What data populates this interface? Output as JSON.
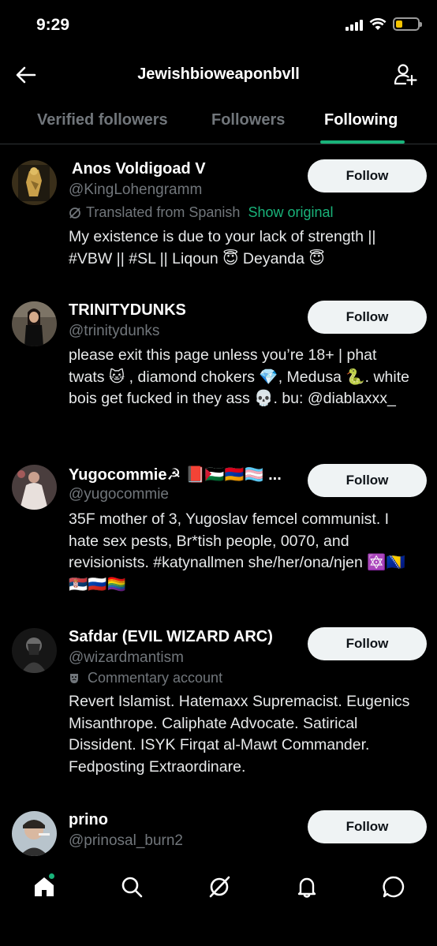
{
  "status_bar": {
    "time": "9:29",
    "icons": [
      "signal-icon",
      "wifi-icon",
      "battery-icon"
    ],
    "battery_color": "#f5c400"
  },
  "header": {
    "title": "Jewishbioweaponbvll",
    "back_icon": "back-arrow-icon",
    "add_icon": "add-user-icon"
  },
  "tabs": [
    {
      "label": "Verified followers",
      "active": false
    },
    {
      "label": "Followers",
      "active": false
    },
    {
      "label": "Following",
      "active": true
    }
  ],
  "accent_color": "#19b37a",
  "users": [
    {
      "name": "Anos Voldigoad V",
      "handle": "@KingLohengramm",
      "translated_label": "Translated from Spanish",
      "show_original": "Show original",
      "bio": "My existence is due to your lack of strength || #VBW || #SL || Liqoun 😇 Deyanda 😇",
      "follow_label": "Follow"
    },
    {
      "name": "TRINITYDUNKS",
      "handle": "@trinitydunks",
      "bio": "please exit this page unless you’re 18+ | phat twats 🐱 , diamond chokers 💎, Medusa 🐍. white bois get fucked in they ass 💀. bu: @diablaxxx_",
      "follow_label": "Follow"
    },
    {
      "name": "Yugocommie☭ 📕🇵🇸🇦🇲🏳️‍⚧️ ...",
      "handle": "@yugocommie",
      "bio": "35F mother of 3, Yugoslav femcel communist. I hate sex pests, Br*tish people, 0070, and revisionists. #katynallmen she/her/ona/njen 🔯🇧🇦🇷🇸🇷🇺🏳️‍🌈",
      "follow_label": "Follow"
    },
    {
      "name": "Safdar (EVIL WIZARD ARC)",
      "handle": "@wizardmantism",
      "commentary_label": "Commentary account",
      "bio": "Revert Islamist. Hatemaxx Supremacist. Eugenics Misanthrope. Caliphate Advocate. Satirical Dissident. ISYK Firqat al-Mawt Commander. Fedposting Extraordinare.",
      "follow_label": "Follow"
    },
    {
      "name": "prino",
      "handle": "@prinosal_burn2",
      "follow_label": "Follow"
    }
  ],
  "bottom_nav": [
    "home-icon",
    "search-icon",
    "grok-icon",
    "notifications-icon",
    "messages-icon"
  ]
}
